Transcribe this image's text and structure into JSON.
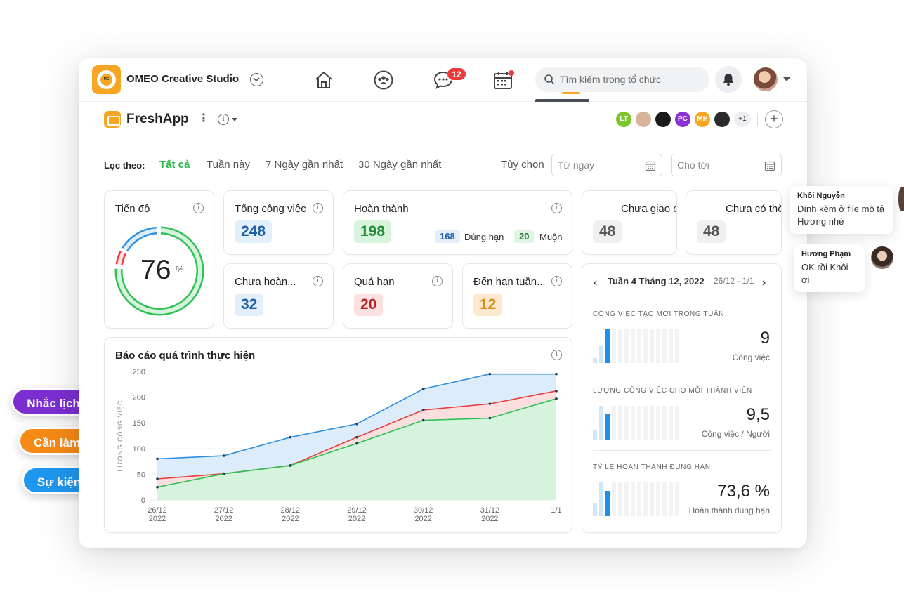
{
  "header": {
    "org_name": "OMEO Creative Studio",
    "logo_text": "MC",
    "chat_badge": "12",
    "search_placeholder": "Tìm kiếm trong tổ chức"
  },
  "project": {
    "name": "FreshApp",
    "more": "⋮",
    "info": "i",
    "members": [
      {
        "initials": "LT",
        "color": "#7cc62d"
      },
      {
        "initials": "",
        "color": "#d8b49c"
      },
      {
        "initials": "",
        "color": "#1a1a1a"
      },
      {
        "initials": "PC",
        "color": "#8e2fd6"
      },
      {
        "initials": "MH",
        "color": "#f6a623"
      },
      {
        "initials": "",
        "color": "#2b2b2b"
      }
    ],
    "more_members": "+1",
    "add": "+"
  },
  "filter": {
    "label": "Lọc theo:",
    "options": [
      "Tất cả",
      "Tuần này",
      "7 Ngày gần nhất",
      "30 Ngày gần nhất"
    ],
    "custom_label": "Tùy chọn",
    "from_placeholder": "Từ ngày",
    "to_placeholder": "Cho tới"
  },
  "progress": {
    "title": "Tiến độ",
    "value": "76",
    "unit": "%",
    "percent": 0.76,
    "colors": {
      "green": "#2ec254",
      "red": "#ea3a3a",
      "blue": "#2f8fe0"
    }
  },
  "stats": {
    "total": {
      "title": "Tổng công việc",
      "value": "248"
    },
    "done": {
      "title": "Hoàn thành",
      "value": "198",
      "ontime_value": "168",
      "ontime_label": "Đúng hạn",
      "late_value": "20",
      "late_label": "Muộn"
    },
    "unassigned": {
      "title": "Chưa giao c",
      "value": "48"
    },
    "nodate": {
      "title": "Chưa có thờ",
      "value": "48"
    },
    "incomplete": {
      "title": "Chưa hoàn...",
      "value": "32"
    },
    "overdue": {
      "title": "Quá hạn",
      "value": "20"
    },
    "due_week": {
      "title": "Đến hạn tuần...",
      "value": "12"
    }
  },
  "chart": {
    "title": "Báo cáo quá trình thực hiện",
    "ylabel": "LƯỢNG CÔNG VIỆC"
  },
  "chart_data": {
    "type": "area",
    "title": "Báo cáo quá trình thực hiện",
    "ylabel": "LƯỢNG CÔNG VIỆC",
    "xlabel": "",
    "ylim": [
      0,
      250
    ],
    "yticks": [
      0,
      50,
      100,
      150,
      200,
      250
    ],
    "x": [
      "26/12\n2022",
      "27/12\n2022",
      "28/12\n2022",
      "29/12\n2022",
      "30/12\n2022",
      "31/12\n2022",
      "1/1"
    ],
    "series": [
      {
        "color": "#2f8fe0",
        "fill": "#dcecfa",
        "values": [
          80,
          86,
          122,
          148,
          216,
          245,
          245
        ]
      },
      {
        "color": "#ea3a3a",
        "fill": "#fbdede",
        "values": [
          41,
          51,
          67,
          122,
          175,
          187,
          212
        ]
      },
      {
        "color": "#2ec254",
        "fill": "#d5f3dd",
        "values": [
          25,
          51,
          67,
          110,
          155,
          159,
          197
        ]
      }
    ],
    "grid": true
  },
  "weekly": {
    "prev": "‹",
    "next": "›",
    "title": "Tuần 4 Tháng 12, 2022",
    "range": "26/12 - 1/1",
    "sections": [
      {
        "title": "CÔNG VIỆC TẠO MỚI TRONG TUẦN",
        "value": "9",
        "unit": "Công việc",
        "bars": [
          0.15,
          0.5,
          1.0
        ]
      },
      {
        "title": "LƯỢNG CÔNG VIỆC CHO MỖI THÀNH VIÊN",
        "value": "9,5",
        "unit": "Công việc / Người",
        "bars": [
          0.3,
          1.0,
          0.75
        ]
      },
      {
        "title": "TỶ LỆ HOÀN THÀNH ĐÚNG HẠN",
        "value": "73,6 %",
        "unit": "Hoàn thành đúng hạn",
        "bars": [
          0.4,
          1.0,
          0.74
        ]
      }
    ]
  },
  "pills": {
    "reminder": "Nhắc lịch",
    "todo": "Cần làm",
    "event": "Sự kiện"
  },
  "comments": [
    {
      "name": "Khôi Nguyễn",
      "message_line1": "Đính kèm ở file mô tả",
      "message_line2": "Hương nhé"
    },
    {
      "name": "Hương Phạm",
      "message": "OK rồi Khôi ơi"
    }
  ]
}
